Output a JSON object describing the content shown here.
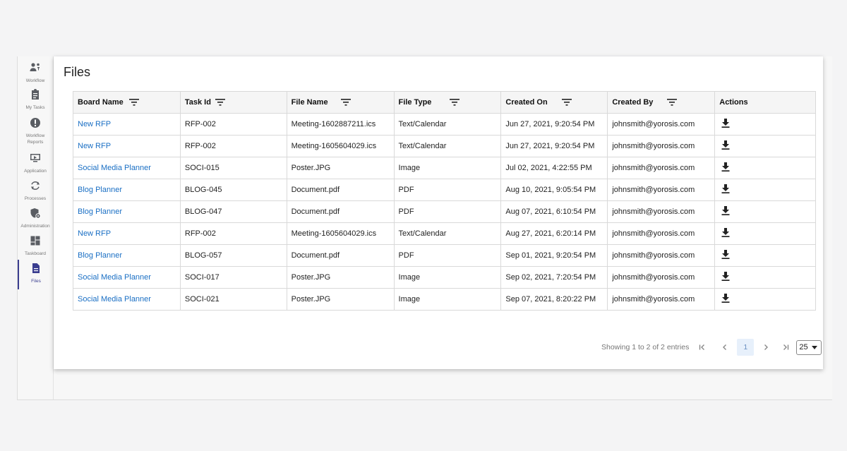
{
  "sidebar": {
    "items": [
      {
        "label": "Workflow",
        "icon": "workflow-icon"
      },
      {
        "label": "My Tasks",
        "icon": "clipboard-icon"
      },
      {
        "label": "Workflow Reports",
        "icon": "alert-circle-icon"
      },
      {
        "label": "Application",
        "icon": "application-icon"
      },
      {
        "label": "Processes",
        "icon": "sync-icon"
      },
      {
        "label": "Administration",
        "icon": "admin-gear-icon"
      },
      {
        "label": "Taskboard",
        "icon": "dashboard-icon"
      },
      {
        "label": "Files",
        "icon": "file-icon",
        "active": true
      }
    ]
  },
  "page": {
    "title": "Files"
  },
  "table": {
    "columns": [
      "Board Name",
      "Task Id",
      "File Name",
      "File Type",
      "Created On",
      "Created By",
      "Actions"
    ],
    "rows": [
      {
        "board": "New RFP",
        "task": "RFP-002",
        "file": "Meeting-1602887211.ics",
        "type": "Text/Calendar",
        "created_on": "Jun 27, 2021, 9:20:54 PM",
        "created_by": "johnsmith@yorosis.com"
      },
      {
        "board": "New RFP",
        "task": "RFP-002",
        "file": "Meeting-1605604029.ics",
        "type": "Text/Calendar",
        "created_on": "Jun 27, 2021, 9:20:54 PM",
        "created_by": "johnsmith@yorosis.com"
      },
      {
        "board": "Social Media Planner",
        "task": "SOCI-015",
        "file": "Poster.JPG",
        "type": "Image",
        "created_on": "Jul 02, 2021, 4:22:55 PM",
        "created_by": "johnsmith@yorosis.com"
      },
      {
        "board": "Blog Planner",
        "task": "BLOG-045",
        "file": "Document.pdf",
        "type": "PDF",
        "created_on": "Aug 10, 2021, 9:05:54 PM",
        "created_by": "johnsmith@yorosis.com"
      },
      {
        "board": "Blog Planner",
        "task": "BLOG-047",
        "file": "Document.pdf",
        "type": "PDF",
        "created_on": "Aug 07, 2021, 6:10:54 PM",
        "created_by": "johnsmith@yorosis.com"
      },
      {
        "board": "New RFP",
        "task": "RFP-002",
        "file": "Meeting-1605604029.ics",
        "type": "Text/Calendar",
        "created_on": "Aug 27, 2021, 6:20:14 PM",
        "created_by": "johnsmith@yorosis.com"
      },
      {
        "board": "Blog Planner",
        "task": "BLOG-057",
        "file": "Document.pdf",
        "type": "PDF",
        "created_on": "Sep 01, 2021, 9:20:54 PM",
        "created_by": "johnsmith@yorosis.com"
      },
      {
        "board": "Social Media Planner",
        "task": "SOCI-017",
        "file": "Poster.JPG",
        "type": "Image",
        "created_on": "Sep 02, 2021, 7:20:54 PM",
        "created_by": "johnsmith@yorosis.com"
      },
      {
        "board": "Social Media Planner",
        "task": "SOCI-021",
        "file": "Poster.JPG",
        "type": "Image",
        "created_on": "Sep 07, 2021, 8:20:22 PM",
        "created_by": "johnsmith@yorosis.com"
      }
    ]
  },
  "pagination": {
    "info": "Showing 1 to 2 of 2 entries",
    "current_page": "1",
    "page_size": "25"
  },
  "colors": {
    "link": "#1a6fc4",
    "active_nav": "#3a3d8f",
    "page_highlight": "#e7f0fb"
  }
}
